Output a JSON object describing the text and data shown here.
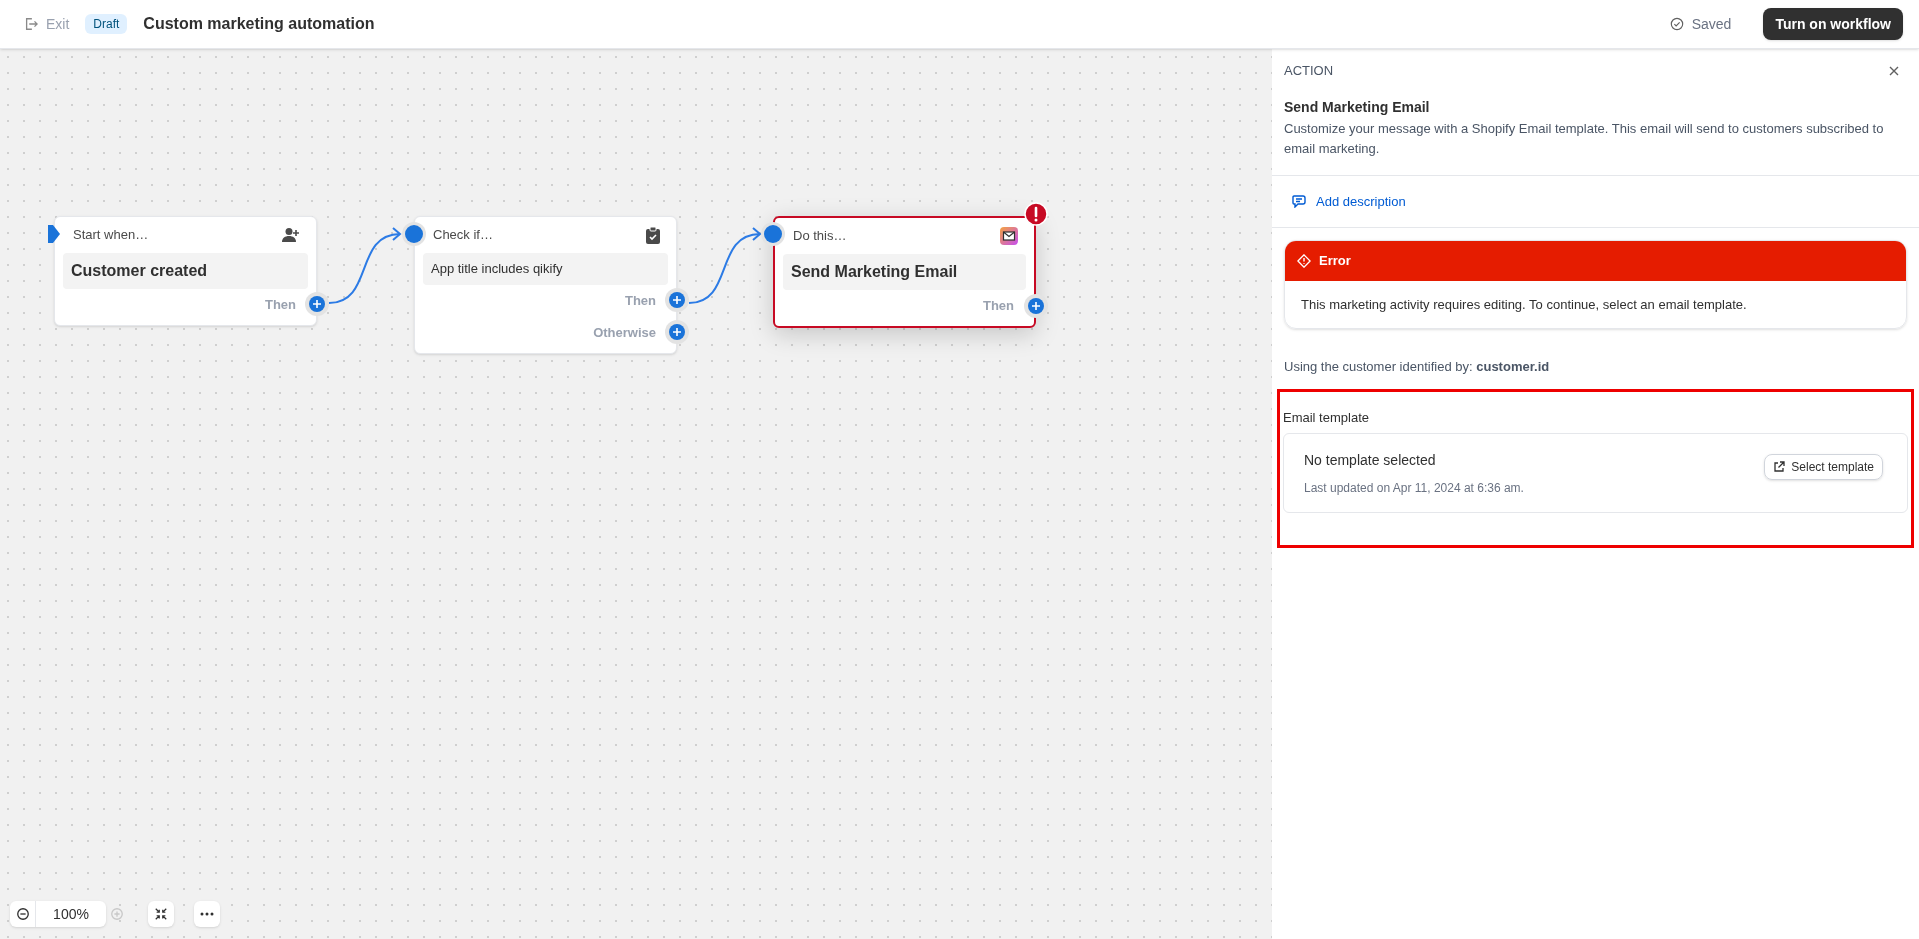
{
  "topbar": {
    "exit": "Exit",
    "badge": "Draft",
    "title": "Custom marketing automation",
    "saved": "Saved",
    "primary_button": "Turn on workflow"
  },
  "nodes": [
    {
      "kind": "trigger",
      "header": "Start when…",
      "body": "Customer created",
      "outputs": [
        "Then"
      ],
      "error": false,
      "selected": false
    },
    {
      "kind": "condition",
      "header": "Check if…",
      "body": "App title includes qikify",
      "outputs": [
        "Then",
        "Otherwise"
      ],
      "error": false,
      "selected": false
    },
    {
      "kind": "action",
      "header": "Do this…",
      "body": "Send Marketing Email",
      "outputs": [
        "Then"
      ],
      "error": true,
      "selected": true
    }
  ],
  "zoom": {
    "value": "100%"
  },
  "panel": {
    "eyebrow": "ACTION",
    "title": "Send Marketing Email",
    "description": "Customize your message with a Shopify Email template. This email will send to customers subscribed to email marketing.",
    "add_description": "Add description",
    "error": {
      "title": "Error",
      "message": "This marketing activity requires editing. To continue, select an email template."
    },
    "identifier": "Using the customer identified by: **customer.id**",
    "email_template": {
      "label": "Email template",
      "name": "No template selected",
      "meta": "Last updated on Apr 11, 2024 at 6:36 am.",
      "button": "Select template"
    }
  }
}
